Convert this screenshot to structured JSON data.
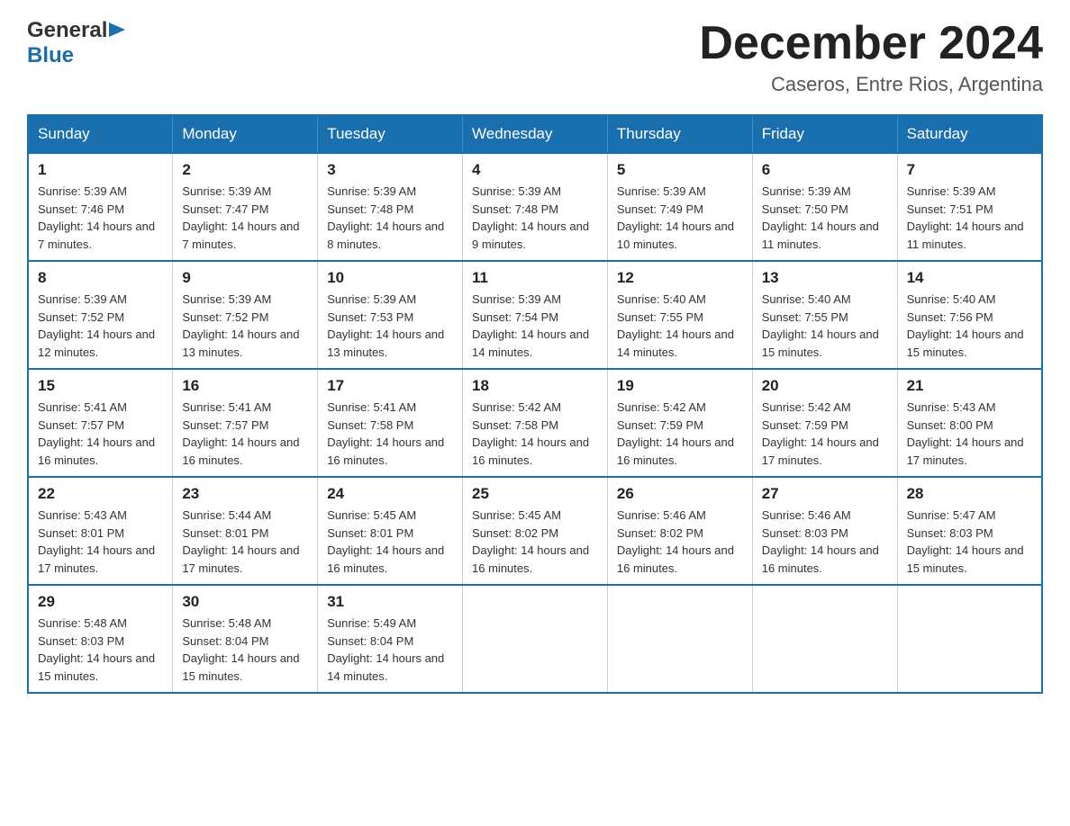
{
  "header": {
    "logo_general": "General",
    "logo_blue": "Blue",
    "month_title": "December 2024",
    "subtitle": "Caseros, Entre Rios, Argentina"
  },
  "days_of_week": [
    "Sunday",
    "Monday",
    "Tuesday",
    "Wednesday",
    "Thursday",
    "Friday",
    "Saturday"
  ],
  "weeks": [
    [
      {
        "day": "1",
        "sunrise": "Sunrise: 5:39 AM",
        "sunset": "Sunset: 7:46 PM",
        "daylight": "Daylight: 14 hours and 7 minutes."
      },
      {
        "day": "2",
        "sunrise": "Sunrise: 5:39 AM",
        "sunset": "Sunset: 7:47 PM",
        "daylight": "Daylight: 14 hours and 7 minutes."
      },
      {
        "day": "3",
        "sunrise": "Sunrise: 5:39 AM",
        "sunset": "Sunset: 7:48 PM",
        "daylight": "Daylight: 14 hours and 8 minutes."
      },
      {
        "day": "4",
        "sunrise": "Sunrise: 5:39 AM",
        "sunset": "Sunset: 7:48 PM",
        "daylight": "Daylight: 14 hours and 9 minutes."
      },
      {
        "day": "5",
        "sunrise": "Sunrise: 5:39 AM",
        "sunset": "Sunset: 7:49 PM",
        "daylight": "Daylight: 14 hours and 10 minutes."
      },
      {
        "day": "6",
        "sunrise": "Sunrise: 5:39 AM",
        "sunset": "Sunset: 7:50 PM",
        "daylight": "Daylight: 14 hours and 11 minutes."
      },
      {
        "day": "7",
        "sunrise": "Sunrise: 5:39 AM",
        "sunset": "Sunset: 7:51 PM",
        "daylight": "Daylight: 14 hours and 11 minutes."
      }
    ],
    [
      {
        "day": "8",
        "sunrise": "Sunrise: 5:39 AM",
        "sunset": "Sunset: 7:52 PM",
        "daylight": "Daylight: 14 hours and 12 minutes."
      },
      {
        "day": "9",
        "sunrise": "Sunrise: 5:39 AM",
        "sunset": "Sunset: 7:52 PM",
        "daylight": "Daylight: 14 hours and 13 minutes."
      },
      {
        "day": "10",
        "sunrise": "Sunrise: 5:39 AM",
        "sunset": "Sunset: 7:53 PM",
        "daylight": "Daylight: 14 hours and 13 minutes."
      },
      {
        "day": "11",
        "sunrise": "Sunrise: 5:39 AM",
        "sunset": "Sunset: 7:54 PM",
        "daylight": "Daylight: 14 hours and 14 minutes."
      },
      {
        "day": "12",
        "sunrise": "Sunrise: 5:40 AM",
        "sunset": "Sunset: 7:55 PM",
        "daylight": "Daylight: 14 hours and 14 minutes."
      },
      {
        "day": "13",
        "sunrise": "Sunrise: 5:40 AM",
        "sunset": "Sunset: 7:55 PM",
        "daylight": "Daylight: 14 hours and 15 minutes."
      },
      {
        "day": "14",
        "sunrise": "Sunrise: 5:40 AM",
        "sunset": "Sunset: 7:56 PM",
        "daylight": "Daylight: 14 hours and 15 minutes."
      }
    ],
    [
      {
        "day": "15",
        "sunrise": "Sunrise: 5:41 AM",
        "sunset": "Sunset: 7:57 PM",
        "daylight": "Daylight: 14 hours and 16 minutes."
      },
      {
        "day": "16",
        "sunrise": "Sunrise: 5:41 AM",
        "sunset": "Sunset: 7:57 PM",
        "daylight": "Daylight: 14 hours and 16 minutes."
      },
      {
        "day": "17",
        "sunrise": "Sunrise: 5:41 AM",
        "sunset": "Sunset: 7:58 PM",
        "daylight": "Daylight: 14 hours and 16 minutes."
      },
      {
        "day": "18",
        "sunrise": "Sunrise: 5:42 AM",
        "sunset": "Sunset: 7:58 PM",
        "daylight": "Daylight: 14 hours and 16 minutes."
      },
      {
        "day": "19",
        "sunrise": "Sunrise: 5:42 AM",
        "sunset": "Sunset: 7:59 PM",
        "daylight": "Daylight: 14 hours and 16 minutes."
      },
      {
        "day": "20",
        "sunrise": "Sunrise: 5:42 AM",
        "sunset": "Sunset: 7:59 PM",
        "daylight": "Daylight: 14 hours and 17 minutes."
      },
      {
        "day": "21",
        "sunrise": "Sunrise: 5:43 AM",
        "sunset": "Sunset: 8:00 PM",
        "daylight": "Daylight: 14 hours and 17 minutes."
      }
    ],
    [
      {
        "day": "22",
        "sunrise": "Sunrise: 5:43 AM",
        "sunset": "Sunset: 8:01 PM",
        "daylight": "Daylight: 14 hours and 17 minutes."
      },
      {
        "day": "23",
        "sunrise": "Sunrise: 5:44 AM",
        "sunset": "Sunset: 8:01 PM",
        "daylight": "Daylight: 14 hours and 17 minutes."
      },
      {
        "day": "24",
        "sunrise": "Sunrise: 5:45 AM",
        "sunset": "Sunset: 8:01 PM",
        "daylight": "Daylight: 14 hours and 16 minutes."
      },
      {
        "day": "25",
        "sunrise": "Sunrise: 5:45 AM",
        "sunset": "Sunset: 8:02 PM",
        "daylight": "Daylight: 14 hours and 16 minutes."
      },
      {
        "day": "26",
        "sunrise": "Sunrise: 5:46 AM",
        "sunset": "Sunset: 8:02 PM",
        "daylight": "Daylight: 14 hours and 16 minutes."
      },
      {
        "day": "27",
        "sunrise": "Sunrise: 5:46 AM",
        "sunset": "Sunset: 8:03 PM",
        "daylight": "Daylight: 14 hours and 16 minutes."
      },
      {
        "day": "28",
        "sunrise": "Sunrise: 5:47 AM",
        "sunset": "Sunset: 8:03 PM",
        "daylight": "Daylight: 14 hours and 15 minutes."
      }
    ],
    [
      {
        "day": "29",
        "sunrise": "Sunrise: 5:48 AM",
        "sunset": "Sunset: 8:03 PM",
        "daylight": "Daylight: 14 hours and 15 minutes."
      },
      {
        "day": "30",
        "sunrise": "Sunrise: 5:48 AM",
        "sunset": "Sunset: 8:04 PM",
        "daylight": "Daylight: 14 hours and 15 minutes."
      },
      {
        "day": "31",
        "sunrise": "Sunrise: 5:49 AM",
        "sunset": "Sunset: 8:04 PM",
        "daylight": "Daylight: 14 hours and 14 minutes."
      },
      null,
      null,
      null,
      null
    ]
  ]
}
